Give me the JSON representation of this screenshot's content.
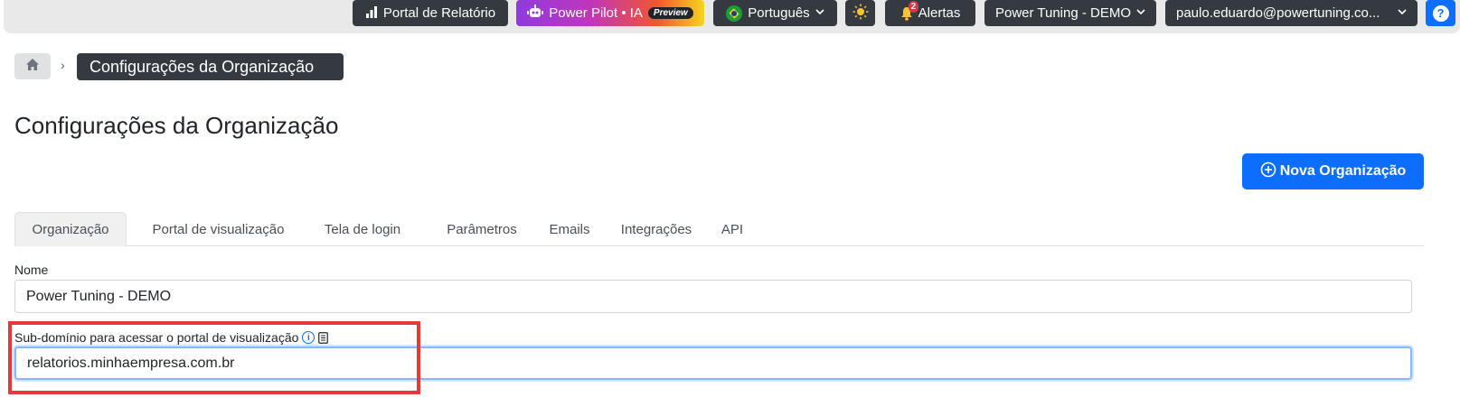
{
  "topbar": {
    "report_portal": "Portal de Relatório",
    "power_pilot": "Power Pilot • IA",
    "preview_badge": "Preview",
    "language": "Português",
    "alerts_label": "Alertas",
    "alerts_count": "2",
    "organization": "Power Tuning - DEMO",
    "user": "paulo.eduardo@powertuning.co...",
    "help": "?"
  },
  "breadcrumb": {
    "separator": "›",
    "current": "Configurações da Organização"
  },
  "page": {
    "title": "Configurações da Organização",
    "new_org_button": "Nova Organização"
  },
  "tabs": [
    {
      "label": "Organização",
      "active": true
    },
    {
      "label": "Portal de visualização",
      "active": false
    },
    {
      "label": "Tela de login",
      "active": false
    },
    {
      "label": "Parâmetros",
      "active": false
    },
    {
      "label": "Emails",
      "active": false
    },
    {
      "label": "Integrações",
      "active": false
    },
    {
      "label": "API",
      "active": false
    }
  ],
  "form": {
    "name_label": "Nome",
    "name_value": "Power Tuning - DEMO",
    "subdomain_label": "Sub-domínio para acessar o portal de visualização",
    "subdomain_value": "relatorios.minhaempresa.com.br"
  },
  "colors": {
    "primary": "#0d6efd",
    "dark": "#343a40",
    "highlight": "#e53935"
  }
}
